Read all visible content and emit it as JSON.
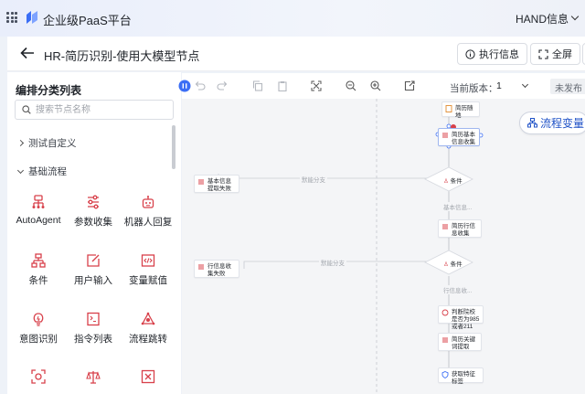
{
  "app": {
    "title": "企业级PaaS平台",
    "company": "HAND信息"
  },
  "header": {
    "title": "HR-简历识别-使用大模型节点",
    "run_info_label": "执行信息",
    "fullscreen_label": "全屏"
  },
  "sidebar": {
    "title": "编排分类列表",
    "search_placeholder": "搜索节点名称",
    "groups": [
      {
        "label": "测试自定义"
      },
      {
        "label": "基础流程"
      }
    ],
    "nodes": [
      {
        "label": "AutoAgent",
        "icon": "robot-network-icon"
      },
      {
        "label": "参数收集",
        "icon": "sliders-icon"
      },
      {
        "label": "机器人回复",
        "icon": "robot-icon"
      },
      {
        "label": "条件",
        "icon": "condition-tree-icon"
      },
      {
        "label": "用户输入",
        "icon": "edit-icon"
      },
      {
        "label": "变量赋值",
        "icon": "code-icon"
      },
      {
        "label": "意图识别",
        "icon": "lightbulb-icon"
      },
      {
        "label": "指令列表",
        "icon": "list-icon"
      },
      {
        "label": "流程跳转",
        "icon": "jump-icon"
      },
      {
        "label": "",
        "icon": "target-icon"
      },
      {
        "label": "",
        "icon": "balance-icon"
      },
      {
        "label": "",
        "icon": "transform-icon"
      }
    ]
  },
  "toolbar": {
    "version_label": "当前版本：",
    "version_value": "1",
    "status": "未发布"
  },
  "canvas": {
    "flow_var_label": "流程变量",
    "nodes": {
      "n1": "简历随地",
      "n2": "简历基本信息收集",
      "n3": "基本信息提取失败",
      "n4": "简历行信息收集",
      "n5": "行信息收集失败",
      "n6": "判断院校是否为985或者211",
      "n7": "简历关键词提取",
      "n8": "获取特征标签"
    },
    "conditions": {
      "c1": "条件",
      "c2": "条件"
    },
    "edges": {
      "e1": "默能分支",
      "e2": "基本信息...",
      "e3": "默能分支",
      "e4": "行信息收..."
    }
  },
  "colors": {
    "accent": "#d8404a",
    "primary": "#1f52c7"
  }
}
